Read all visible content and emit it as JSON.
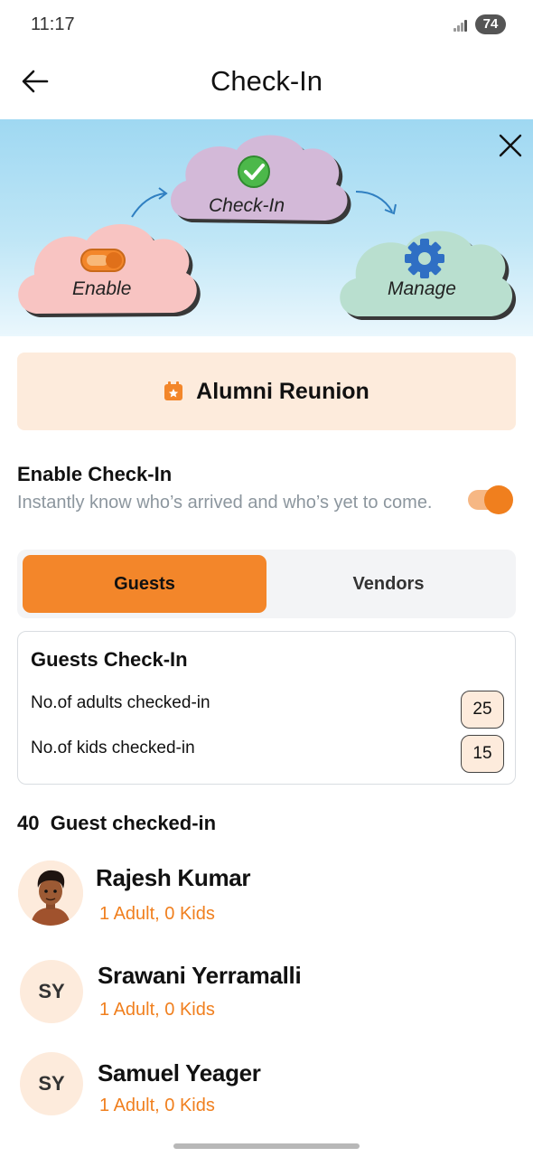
{
  "status_bar": {
    "time": "11:17",
    "battery": "74"
  },
  "header": {
    "title": "Check-In"
  },
  "banner": {
    "steps": [
      {
        "label": "Enable",
        "icon": "toggle-icon"
      },
      {
        "label": "Check-In",
        "icon": "check-circle-icon"
      },
      {
        "label": "Manage",
        "icon": "gear-icon"
      }
    ]
  },
  "event": {
    "name": "Alumni Reunion",
    "icon": "calendar-star-icon"
  },
  "enable_checkin": {
    "title": "Enable Check-In",
    "description": "Instantly know who’s arrived and who’s yet to come.",
    "enabled": true
  },
  "tabs": [
    {
      "label": "Guests",
      "active": true
    },
    {
      "label": "Vendors",
      "active": false
    }
  ],
  "checkin_summary": {
    "title": "Guests Check-In",
    "adults_label": "No.of adults checked-in",
    "adults_count": "25",
    "kids_label": "No.of kids checked-in",
    "kids_count": "15"
  },
  "guest_list": {
    "count": "40",
    "count_label": "Guest checked-in",
    "guests": [
      {
        "name": "Rajesh Kumar",
        "detail": "1 Adult, 0 Kids",
        "initials": ""
      },
      {
        "name": "Srawani Yerramalli",
        "detail": "1 Adult, 0 Kids",
        "initials": "SY"
      },
      {
        "name": "Samuel Yeager",
        "detail": "1 Adult, 0 Kids",
        "initials": "SY"
      }
    ]
  },
  "colors": {
    "accent": "#f3862a",
    "accent_light": "#fdebdc",
    "muted": "#8c969e"
  }
}
